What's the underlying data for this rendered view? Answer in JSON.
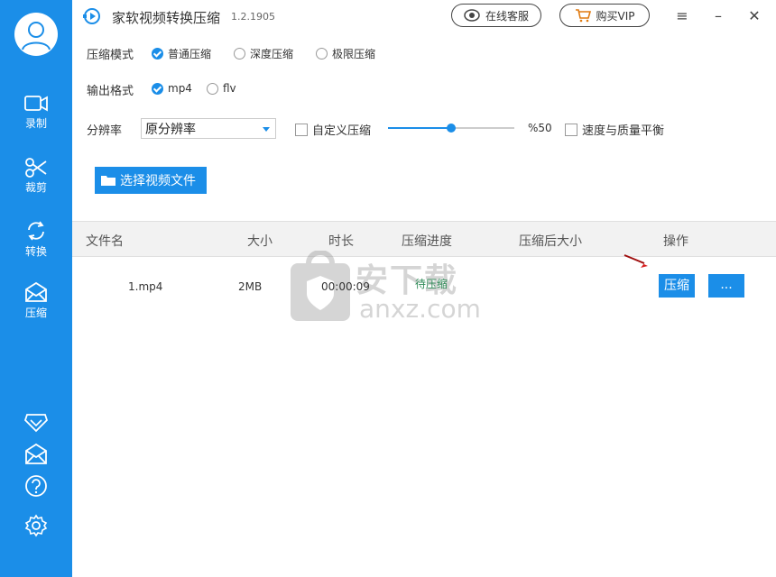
{
  "sidebar": {
    "items": [
      {
        "label": "录制",
        "icon": "record-icon"
      },
      {
        "label": "裁剪",
        "icon": "scissors-icon"
      },
      {
        "label": "转换",
        "icon": "convert-icon"
      },
      {
        "label": "压缩",
        "icon": "compress-envelope-icon",
        "active": true
      }
    ],
    "bottom_icons": [
      "vip-diamond-icon",
      "mail-icon",
      "help-icon",
      "settings-icon"
    ]
  },
  "titlebar": {
    "title": "家软视频转换压缩",
    "version": "1.2.1905",
    "service_button": "在线客服",
    "vip_button": "购买VIP"
  },
  "options": {
    "mode_label": "压缩模式",
    "modes": [
      {
        "label": "普通压缩",
        "checked": true
      },
      {
        "label": "深度压缩",
        "checked": false
      },
      {
        "label": "极限压缩",
        "checked": false
      }
    ],
    "format_label": "输出格式",
    "formats": [
      {
        "label": "mp4",
        "checked": true
      },
      {
        "label": "flv",
        "checked": false
      }
    ],
    "resolution_label": "分辨率",
    "resolution_value": "原分辨率",
    "custom_compress_label": "自定义压缩",
    "custom_compress_checked": false,
    "slider_percent": 50,
    "slider_text": "%50",
    "balance_label": "速度与质量平衡",
    "balance_checked": false
  },
  "select_file_button": "选择视频文件",
  "table": {
    "headers": [
      "文件名",
      "大小",
      "时长",
      "压缩进度",
      "压缩后大小",
      "操作"
    ],
    "rows": [
      {
        "name": "1.mp4",
        "size": "2MB",
        "duration": "00:00:09",
        "progress": "待压缩",
        "compressed_size": "",
        "action": "压缩",
        "more": "..."
      }
    ]
  },
  "watermark": {
    "cn": "安下载",
    "en": "anxz.com"
  },
  "colors": {
    "accent": "#1b8ee8",
    "pending": "#2e8b57"
  }
}
